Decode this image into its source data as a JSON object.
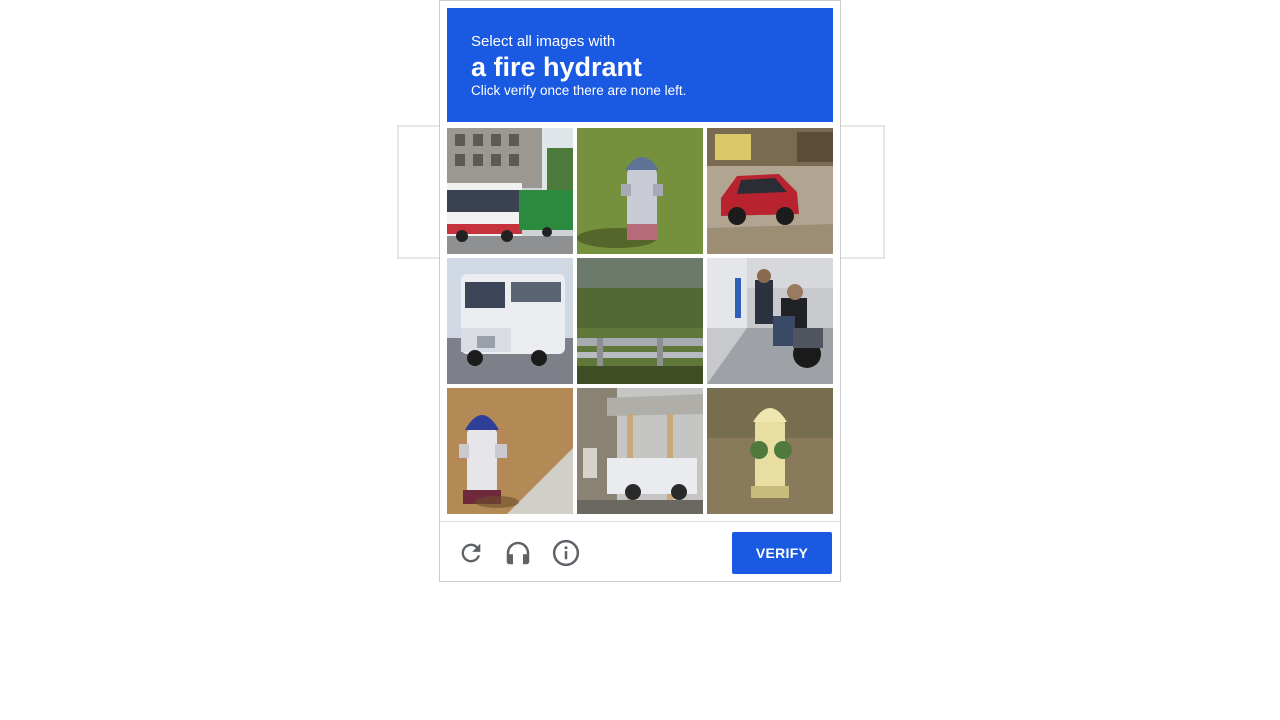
{
  "challenge": {
    "prompt_line1": "Select all images with",
    "prompt_target": "a fire hydrant",
    "prompt_line3": "Click verify once there are none left.",
    "header_color": "#1a59e2"
  },
  "tiles": [
    {
      "label": "street with buses"
    },
    {
      "label": "fire hydrant on grass"
    },
    {
      "label": "red car on dirt road"
    },
    {
      "label": "white school bus"
    },
    {
      "label": "grass and guardrail"
    },
    {
      "label": "people on sidewalk with motorcycle"
    },
    {
      "label": "blue fire hydrant on sidewalk"
    },
    {
      "label": "carport with car"
    },
    {
      "label": "yellow fire hydrant"
    }
  ],
  "footer": {
    "reload_icon": "reload-icon",
    "audio_icon": "headphones-icon",
    "info_icon": "info-icon",
    "verify_label": "VERIFY"
  }
}
